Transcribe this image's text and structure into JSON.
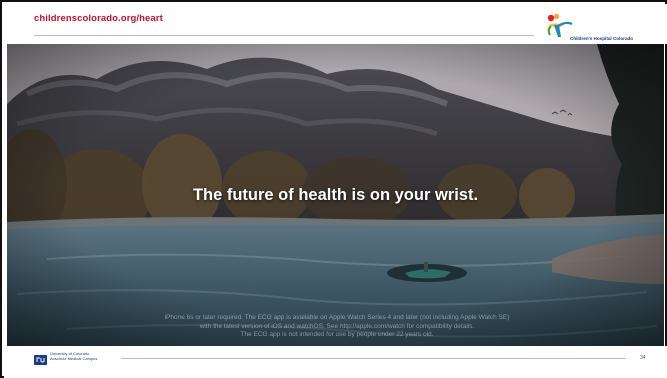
{
  "header": {
    "url": "childrenscolorado.org/heart",
    "logo_text": "Children's Hospital Colorado"
  },
  "slide": {
    "headline": "The future of health is on your wrist.",
    "fineprint_lines": [
      "iPhone 6s or later required. The ECG app is available on Apple Watch Series 4 and later (not including Apple Watch SE)",
      "with the latest version of iOS and watchOS. See http://apple.com/watch for compatibility details.",
      "The ECG app is not intended for use by people under 22 years old."
    ]
  },
  "footer": {
    "logo_lines": [
      "University of Colorado",
      "Anschutz Medical Campus"
    ],
    "page_number": "34"
  },
  "colors": {
    "url_red": "#c8102e",
    "brand_blue": "#1b3a8c"
  }
}
